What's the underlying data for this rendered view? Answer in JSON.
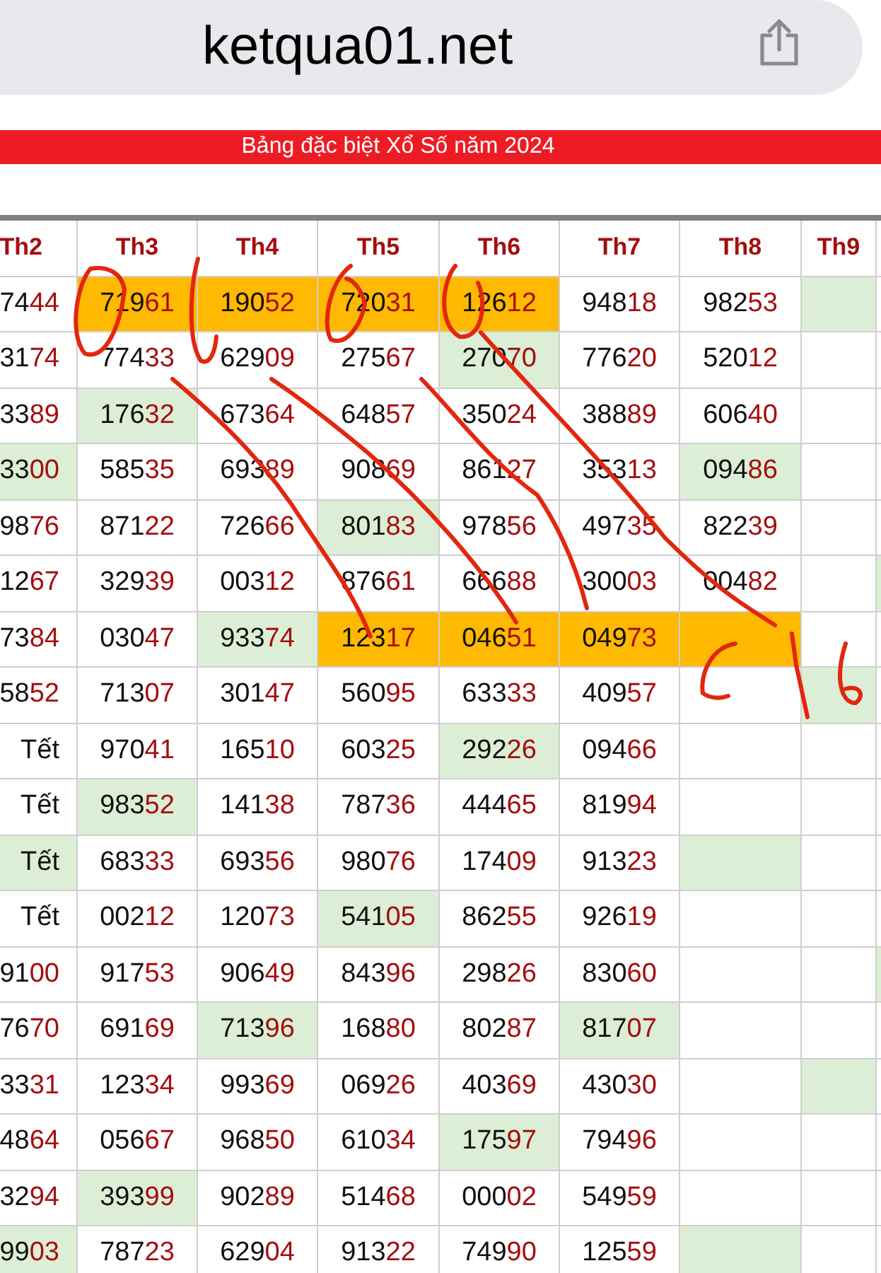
{
  "address_bar": {
    "url": "ketqua01.net"
  },
  "banner": {
    "title": "Bảng đặc biệt Xổ Số năm 2024"
  },
  "table": {
    "columns": [
      "Th2",
      "Th3",
      "Th4",
      "Th5",
      "Th6",
      "Th7",
      "Th8",
      "Th9"
    ],
    "rows": [
      {
        "cells": [
          {
            "head": "74",
            "tail": "44"
          },
          {
            "head": "719",
            "tail": "61",
            "color": "#ffb900"
          },
          {
            "head": "190",
            "tail": "52",
            "color": "#ffb900"
          },
          {
            "head": "720",
            "tail": "31",
            "color": "#ffb900"
          },
          {
            "head": "126",
            "tail": "12",
            "color": "#ffb900"
          },
          {
            "head": "948",
            "tail": "18"
          },
          {
            "head": "982",
            "tail": "53"
          },
          {
            "color": "#dcefd6"
          },
          {}
        ]
      },
      {
        "cells": [
          {
            "head": "31",
            "tail": "74"
          },
          {
            "head": "774",
            "tail": "33"
          },
          {
            "head": "629",
            "tail": "09"
          },
          {
            "head": "275",
            "tail": "67"
          },
          {
            "head": "270",
            "tail": "70",
            "color": "#dcefd6"
          },
          {
            "head": "776",
            "tail": "20"
          },
          {
            "head": "520",
            "tail": "12"
          },
          {},
          {}
        ]
      },
      {
        "cells": [
          {
            "head": "33",
            "tail": "89"
          },
          {
            "head": "176",
            "tail": "32",
            "color": "#dcefd6"
          },
          {
            "head": "673",
            "tail": "64"
          },
          {
            "head": "648",
            "tail": "57"
          },
          {
            "head": "350",
            "tail": "24"
          },
          {
            "head": "388",
            "tail": "89"
          },
          {
            "head": "606",
            "tail": "40"
          },
          {},
          {}
        ]
      },
      {
        "cells": [
          {
            "head": "33",
            "tail": "00",
            "color": "#dcefd6"
          },
          {
            "head": "585",
            "tail": "35"
          },
          {
            "head": "693",
            "tail": "89"
          },
          {
            "head": "908",
            "tail": "69"
          },
          {
            "head": "861",
            "tail": "27"
          },
          {
            "head": "353",
            "tail": "13"
          },
          {
            "head": "094",
            "tail": "86",
            "color": "#dcefd6"
          },
          {},
          {}
        ]
      },
      {
        "cells": [
          {
            "head": "98",
            "tail": "76"
          },
          {
            "head": "871",
            "tail": "22"
          },
          {
            "head": "726",
            "tail": "66"
          },
          {
            "head": "801",
            "tail": "83",
            "color": "#dcefd6"
          },
          {
            "head": "978",
            "tail": "56"
          },
          {
            "head": "497",
            "tail": "35"
          },
          {
            "head": "822",
            "tail": "39"
          },
          {},
          {}
        ]
      },
      {
        "cells": [
          {
            "head": "12",
            "tail": "67"
          },
          {
            "head": "329",
            "tail": "39"
          },
          {
            "head": "003",
            "tail": "12"
          },
          {
            "head": "876",
            "tail": "61"
          },
          {
            "head": "666",
            "tail": "88"
          },
          {
            "head": "300",
            "tail": "03"
          },
          {
            "head": "004",
            "tail": "82"
          },
          {},
          {
            "color": "#dcefd6"
          }
        ]
      },
      {
        "cells": [
          {
            "head": "73",
            "tail": "84"
          },
          {
            "head": "030",
            "tail": "47"
          },
          {
            "head": "933",
            "tail": "74",
            "color": "#dcefd6"
          },
          {
            "head": "123",
            "tail": "17",
            "color": "#ffb900"
          },
          {
            "head": "046",
            "tail": "51",
            "color": "#ffb900"
          },
          {
            "head": "049",
            "tail": "73",
            "color": "#ffb900"
          },
          {
            "color": "#ffb900"
          },
          {},
          {}
        ]
      },
      {
        "cells": [
          {
            "head": "58",
            "tail": "52"
          },
          {
            "head": "713",
            "tail": "07"
          },
          {
            "head": "301",
            "tail": "47"
          },
          {
            "head": "560",
            "tail": "95"
          },
          {
            "head": "633",
            "tail": "33"
          },
          {
            "head": "409",
            "tail": "57"
          },
          {},
          {
            "color": "#dcefd6"
          },
          {}
        ]
      },
      {
        "cells": [
          {
            "head": "Tết"
          },
          {
            "head": "970",
            "tail": "41"
          },
          {
            "head": "165",
            "tail": "10"
          },
          {
            "head": "603",
            "tail": "25"
          },
          {
            "head": "292",
            "tail": "26",
            "color": "#dcefd6"
          },
          {
            "head": "094",
            "tail": "66"
          },
          {},
          {},
          {}
        ]
      },
      {
        "cells": [
          {
            "head": "Tết"
          },
          {
            "head": "983",
            "tail": "52",
            "color": "#dcefd6"
          },
          {
            "head": "141",
            "tail": "38"
          },
          {
            "head": "787",
            "tail": "36"
          },
          {
            "head": "444",
            "tail": "65"
          },
          {
            "head": "819",
            "tail": "94"
          },
          {},
          {},
          {}
        ]
      },
      {
        "cells": [
          {
            "head": "Tết",
            "color": "#dcefd6"
          },
          {
            "head": "683",
            "tail": "33"
          },
          {
            "head": "693",
            "tail": "56"
          },
          {
            "head": "980",
            "tail": "76"
          },
          {
            "head": "174",
            "tail": "09"
          },
          {
            "head": "913",
            "tail": "23"
          },
          {
            "color": "#dcefd6"
          },
          {},
          {}
        ]
      },
      {
        "cells": [
          {
            "head": "Tết"
          },
          {
            "head": "002",
            "tail": "12"
          },
          {
            "head": "120",
            "tail": "73"
          },
          {
            "head": "541",
            "tail": "05",
            "color": "#dcefd6"
          },
          {
            "head": "862",
            "tail": "55"
          },
          {
            "head": "926",
            "tail": "19"
          },
          {},
          {},
          {}
        ]
      },
      {
        "cells": [
          {
            "head": "91",
            "tail": "00"
          },
          {
            "head": "917",
            "tail": "53"
          },
          {
            "head": "906",
            "tail": "49"
          },
          {
            "head": "843",
            "tail": "96"
          },
          {
            "head": "298",
            "tail": "26"
          },
          {
            "head": "830",
            "tail": "60"
          },
          {},
          {},
          {
            "color": "#dcefd6"
          }
        ]
      },
      {
        "cells": [
          {
            "head": "76",
            "tail": "70"
          },
          {
            "head": "691",
            "tail": "69"
          },
          {
            "head": "713",
            "tail": "96",
            "color": "#dcefd6"
          },
          {
            "head": "168",
            "tail": "80"
          },
          {
            "head": "802",
            "tail": "87"
          },
          {
            "head": "817",
            "tail": "07",
            "color": "#dcefd6"
          },
          {},
          {},
          {}
        ]
      },
      {
        "cells": [
          {
            "head": "33",
            "tail": "31"
          },
          {
            "head": "123",
            "tail": "34"
          },
          {
            "head": "993",
            "tail": "69"
          },
          {
            "head": "069",
            "tail": "26"
          },
          {
            "head": "403",
            "tail": "69"
          },
          {
            "head": "430",
            "tail": "30"
          },
          {},
          {
            "color": "#dcefd6"
          },
          {}
        ]
      },
      {
        "cells": [
          {
            "head": "48",
            "tail": "64"
          },
          {
            "head": "056",
            "tail": "67"
          },
          {
            "head": "968",
            "tail": "50"
          },
          {
            "head": "610",
            "tail": "34"
          },
          {
            "head": "175",
            "tail": "97",
            "color": "#dcefd6"
          },
          {
            "head": "794",
            "tail": "96"
          },
          {},
          {},
          {}
        ]
      },
      {
        "cells": [
          {
            "head": "32",
            "tail": "94"
          },
          {
            "head": "393",
            "tail": "99",
            "color": "#dcefd6"
          },
          {
            "head": "902",
            "tail": "89"
          },
          {
            "head": "514",
            "tail": "68"
          },
          {
            "head": "000",
            "tail": "02"
          },
          {
            "head": "549",
            "tail": "59"
          },
          {},
          {},
          {}
        ]
      },
      {
        "cells": [
          {
            "head": "99",
            "tail": "03",
            "color": "#dcefd6"
          },
          {
            "head": "787",
            "tail": "23"
          },
          {
            "head": "629",
            "tail": "04"
          },
          {
            "head": "913",
            "tail": "22"
          },
          {
            "head": "749",
            "tail": "90"
          },
          {
            "head": "125",
            "tail": "59"
          },
          {
            "color": "#dcefd6"
          },
          {},
          {}
        ]
      }
    ]
  }
}
